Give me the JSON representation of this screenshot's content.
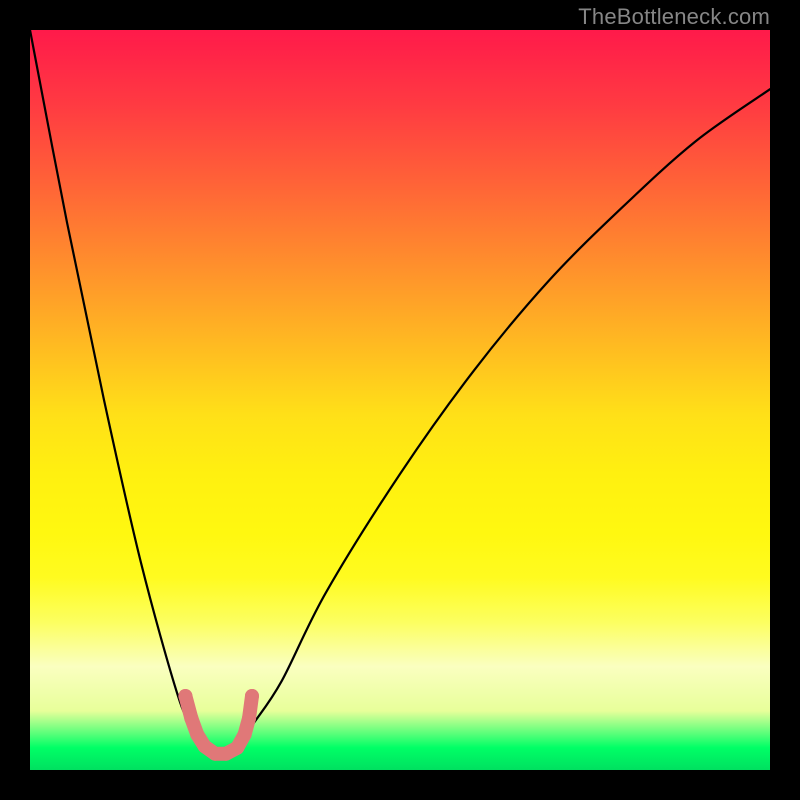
{
  "watermark": "TheBottleneck.com",
  "chart_data": {
    "type": "line",
    "title": "",
    "xlabel": "",
    "ylabel": "",
    "xlim": [
      0,
      100
    ],
    "ylim": [
      0,
      100
    ],
    "grid": false,
    "legend": false,
    "series": [
      {
        "name": "bottleneck-curve",
        "color": "#000000",
        "x": [
          0,
          5,
          10,
          15,
          20,
          22,
          24,
          26,
          28,
          30,
          34,
          40,
          50,
          60,
          70,
          80,
          90,
          100
        ],
        "y": [
          100,
          74,
          50,
          28,
          10,
          6,
          3,
          2,
          3,
          6,
          12,
          24,
          40,
          54,
          66,
          76,
          85,
          92
        ]
      },
      {
        "name": "data-band-markers",
        "color": "#e07878",
        "type": "scatter",
        "marker_size": 14,
        "x": [
          21.0,
          21.8,
          22.6,
          23.6,
          25.0,
          26.5,
          28.0,
          29.0,
          29.6,
          30.0
        ],
        "y": [
          10.0,
          7.0,
          4.8,
          3.2,
          2.2,
          2.2,
          3.0,
          4.8,
          7.0,
          10.0
        ]
      }
    ],
    "annotations": []
  },
  "colors": {
    "background": "#000000",
    "gradient_top": "#ff1a4a",
    "gradient_bottom": "#00e060",
    "curve": "#000000",
    "markers": "#e07878",
    "watermark": "#868686"
  }
}
